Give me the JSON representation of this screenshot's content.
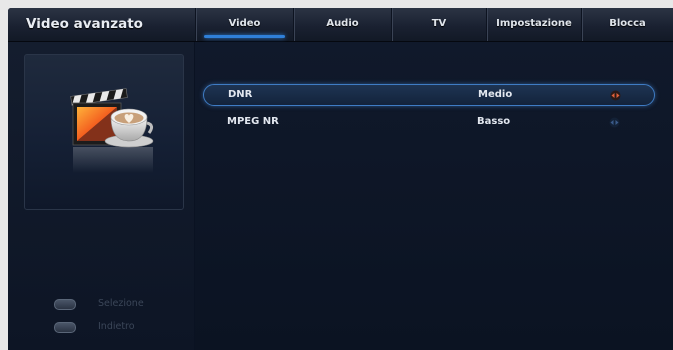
{
  "header": {
    "title": "Video avanzato"
  },
  "tabs": [
    {
      "label": "Video",
      "active": true
    },
    {
      "label": "Audio",
      "active": false
    },
    {
      "label": "TV",
      "active": false
    },
    {
      "label": "Impostazione",
      "active": false
    },
    {
      "label": "Blocca",
      "active": false
    }
  ],
  "settings": [
    {
      "label": "DNR",
      "value": "Medio",
      "selected": true
    },
    {
      "label": "MPEG NR",
      "value": "Basso",
      "selected": false
    }
  ],
  "hints": [
    {
      "key_icon": "ok-key-icon",
      "label": "Selezione"
    },
    {
      "key_icon": "return-key-icon",
      "label": "Indietro"
    }
  ],
  "colors": {
    "accent": "#2f7fd8",
    "background": "#0a1222",
    "selected_arrow": "#e0603a",
    "arrow": "#3a5a8a"
  }
}
